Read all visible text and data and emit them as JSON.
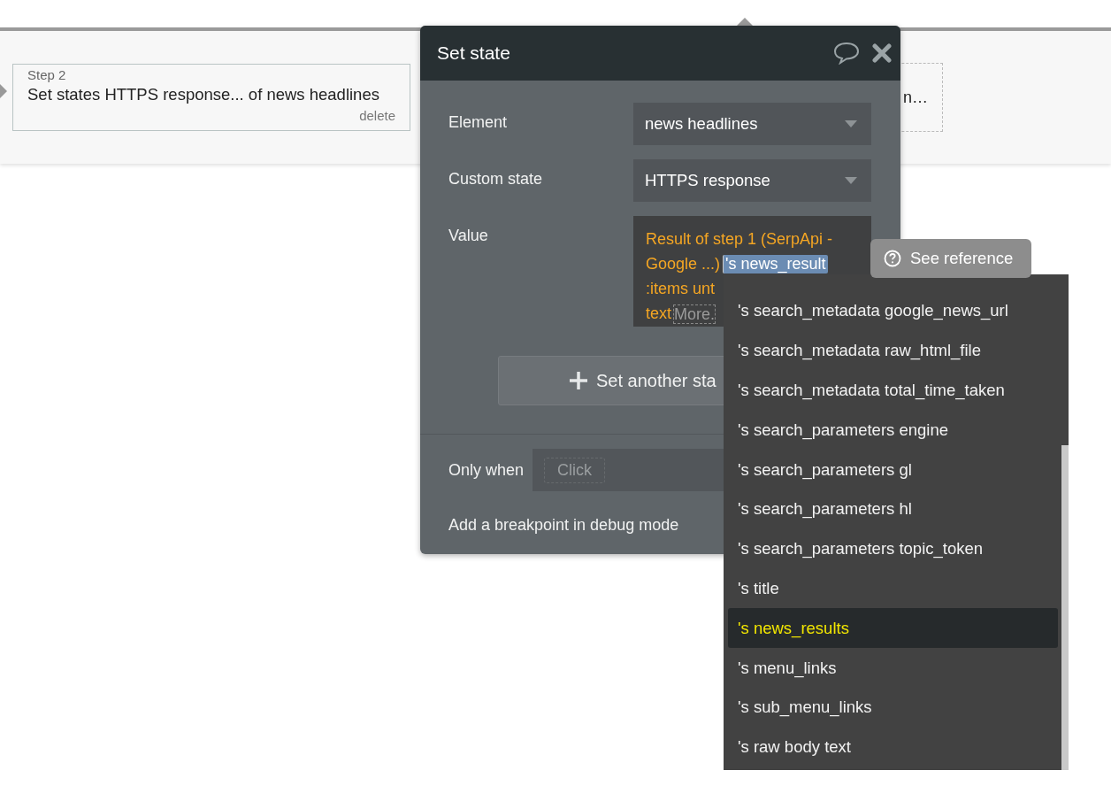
{
  "workflow": {
    "step_card": {
      "step": "Step 2",
      "title": "Set states HTTPS response... of news headlines",
      "delete": "delete"
    },
    "next_card": {
      "text": "n…"
    }
  },
  "popup": {
    "title": "Set state",
    "fields": [
      {
        "label": "Element",
        "kind": "dropdown",
        "value": "news headlines"
      },
      {
        "label": "Custom state",
        "kind": "dropdown",
        "value": "HTTPS response"
      },
      {
        "label": "Value",
        "kind": "expression",
        "lines": [
          {
            "text": "Result of step 1 (SerpApi -"
          },
          {
            "text": "Google ...)",
            "token": "'s news_result"
          },
          {
            "text": ":items unt"
          },
          {
            "text": "text",
            "more": "More."
          }
        ]
      }
    ],
    "add_button": "Set another sta",
    "only_when": {
      "label": "Only when",
      "placeholder": "Click"
    },
    "breakpoint": "Add a breakpoint in debug mode"
  },
  "tooltip": {
    "text": "See reference"
  },
  "suggestions": [
    {
      "label": "'s search_metadata google_news_url",
      "selected": false
    },
    {
      "label": "'s search_metadata raw_html_file",
      "selected": false
    },
    {
      "label": "'s search_metadata total_time_taken",
      "selected": false
    },
    {
      "label": "'s search_parameters engine",
      "selected": false
    },
    {
      "label": "'s search_parameters gl",
      "selected": false
    },
    {
      "label": "'s search_parameters hl",
      "selected": false
    },
    {
      "label": "'s search_parameters topic_token",
      "selected": false
    },
    {
      "label": "'s title",
      "selected": false
    },
    {
      "label": "'s news_results",
      "selected": true
    },
    {
      "label": "'s menu_links",
      "selected": false
    },
    {
      "label": "'s sub_menu_links",
      "selected": false
    },
    {
      "label": "'s raw body text",
      "selected": false
    }
  ]
}
